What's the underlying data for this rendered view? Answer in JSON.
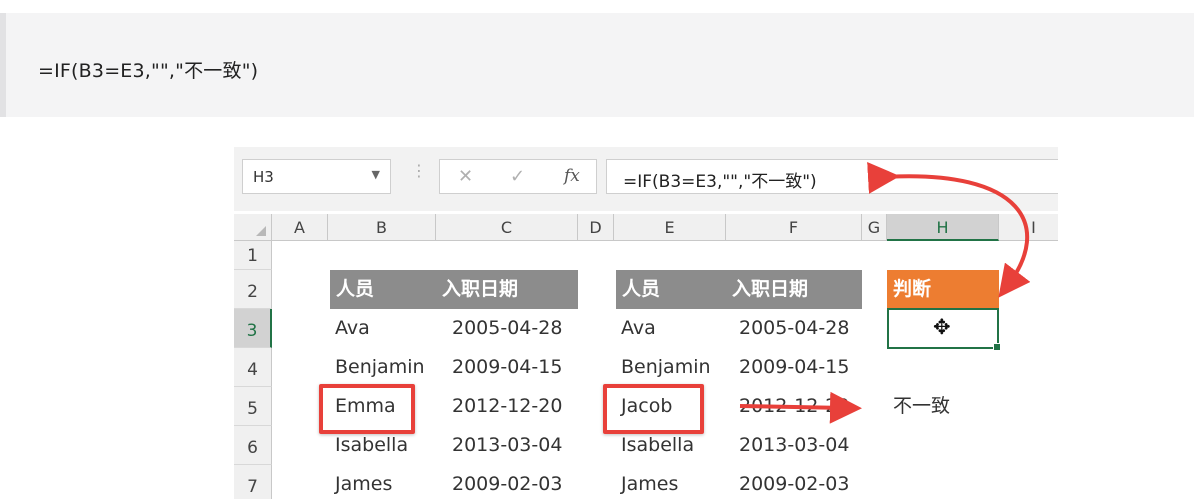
{
  "code_text": "=IF(B3=E3,\"\",\"不一致\")",
  "excel": {
    "name_box": "H3",
    "formula": "=IF(B3=E3,\"\",\"不一致\")",
    "fx_symbol": "fx",
    "cancel_symbol": "✕",
    "enter_symbol": "✓",
    "dropdown_symbol": "▼",
    "divider_symbol": "⋮",
    "columns": [
      "A",
      "B",
      "C",
      "D",
      "E",
      "F",
      "G",
      "H",
      "I"
    ],
    "rows": [
      "1",
      "2",
      "3",
      "4",
      "5",
      "6",
      "7"
    ],
    "table1": {
      "headers": [
        "人员",
        "入职日期"
      ],
      "rows": [
        [
          "Ava",
          "2005-04-28"
        ],
        [
          "Benjamin",
          "2009-04-15"
        ],
        [
          "Emma",
          "2012-12-20"
        ],
        [
          "Isabella",
          "2013-03-04"
        ],
        [
          "James",
          "2009-02-03"
        ]
      ]
    },
    "table2": {
      "headers": [
        "人员",
        "入职日期"
      ],
      "rows": [
        [
          "Ava",
          "2005-04-28"
        ],
        [
          "Benjamin",
          "2009-04-15"
        ],
        [
          "Jacob",
          "2012-12-20"
        ],
        [
          "Isabella",
          "2013-03-04"
        ],
        [
          "James",
          "2009-02-03"
        ]
      ]
    },
    "judge_header": "判断",
    "judge_values": [
      "",
      "",
      "不一致",
      "",
      ""
    ],
    "cursor_glyph": "✥"
  },
  "colors": {
    "header_grey": "#8c8c8c",
    "header_orange": "#ed7d31",
    "excel_green": "#217346",
    "annotation_red": "#e8403a"
  }
}
